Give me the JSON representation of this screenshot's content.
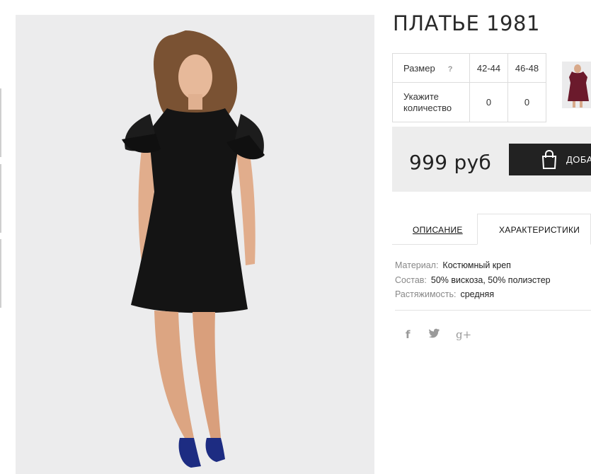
{
  "product": {
    "title": "ПЛАТЬЕ 1981"
  },
  "size_table": {
    "size_label": "Размер",
    "help_mark": "?",
    "sizes": [
      "42-44",
      "46-48"
    ],
    "qty_label": "Укажите количество",
    "quantities": [
      "0",
      "0"
    ]
  },
  "purchase": {
    "price": "999 руб",
    "cart_button_label": "ДОБАВИТЬ В КОРЗИНУ"
  },
  "tabs": {
    "description": "ОПИСАНИЕ",
    "characteristics": "ХАРАКТЕРИСТИКИ",
    "active": "characteristics"
  },
  "specs": [
    {
      "key": "Материал:",
      "value": "Костюмный креп"
    },
    {
      "key": "Состав:",
      "value": "50% вискоза, 50% полиэстер"
    },
    {
      "key": "Растяжимость:",
      "value": "средняя"
    }
  ],
  "social": {
    "facebook": "f",
    "twitter": "t",
    "googleplus": "g+"
  },
  "icons": {
    "cart": "shopping-bag-icon",
    "facebook": "facebook-icon",
    "twitter": "twitter-icon",
    "googleplus": "google-plus-icon"
  },
  "colors": {
    "button_bg": "#222222",
    "price_box_bg": "#ededed",
    "photo_bg": "#ececed",
    "thumb_dress": "#6b1a2c"
  }
}
